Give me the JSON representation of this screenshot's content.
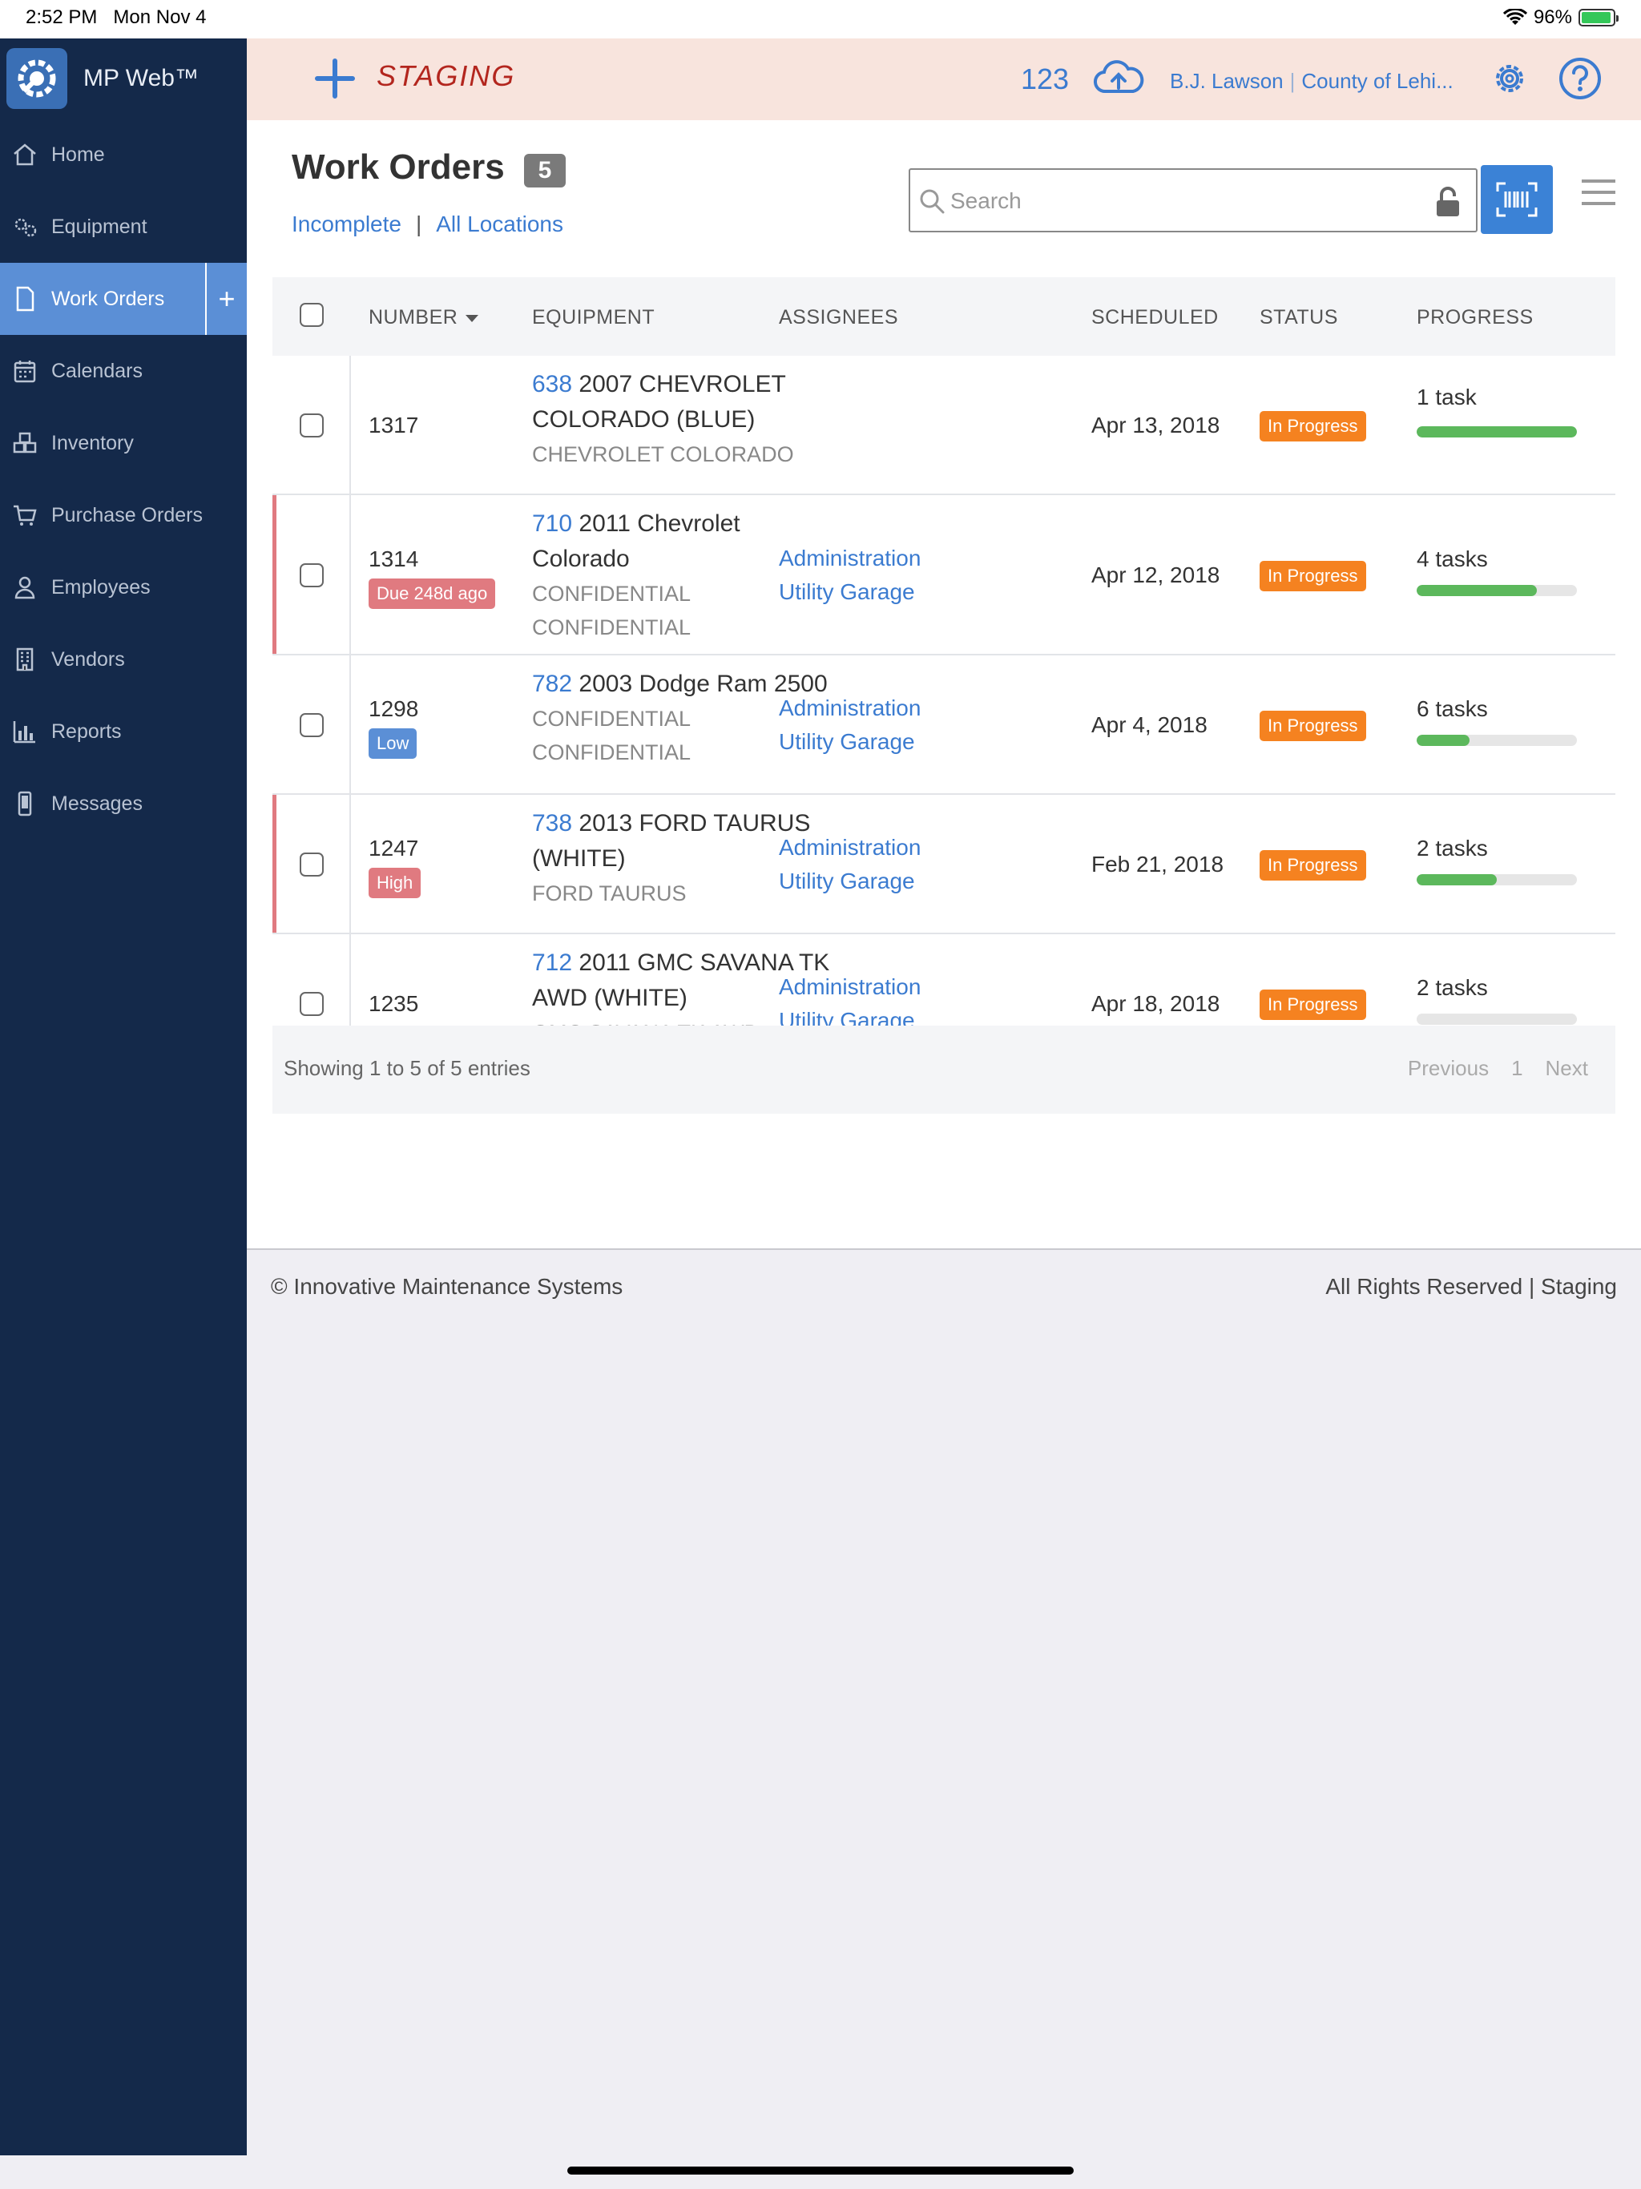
{
  "status_bar": {
    "time": "2:52 PM",
    "date": "Mon Nov 4",
    "battery": "96%",
    "battery_level": 0.96
  },
  "app": {
    "name": "MP Web™"
  },
  "sidebar": {
    "items": [
      {
        "label": "Home",
        "icon": "home-icon"
      },
      {
        "label": "Equipment",
        "icon": "gears-icon"
      },
      {
        "label": "Work Orders",
        "icon": "document-icon",
        "active": true
      },
      {
        "label": "Calendars",
        "icon": "calendar-icon"
      },
      {
        "label": "Inventory",
        "icon": "boxes-icon"
      },
      {
        "label": "Purchase Orders",
        "icon": "cart-icon"
      },
      {
        "label": "Employees",
        "icon": "person-icon"
      },
      {
        "label": "Vendors",
        "icon": "building-icon"
      },
      {
        "label": "Reports",
        "icon": "bar-chart-icon"
      },
      {
        "label": "Messages",
        "icon": "phone-icon"
      }
    ]
  },
  "header": {
    "environment": "STAGING",
    "count": "123",
    "user": "B.J. Lawson",
    "org": "County of Lehi...",
    "accent": "#3b7bd0",
    "env_color": "#b3261e"
  },
  "page": {
    "title": "Work Orders",
    "badge": "5",
    "filter_status": "Incomplete",
    "filter_divider": "|",
    "filter_location": "All Locations",
    "search_placeholder": "Search"
  },
  "table": {
    "headers": {
      "number": "NUMBER",
      "equipment": "EQUIPMENT",
      "assignees": "ASSIGNEES",
      "scheduled": "SCHEDULED",
      "status": "STATUS",
      "progress": "PROGRESS"
    },
    "rows": [
      {
        "number": "1317",
        "badge": "",
        "equip_id": "638",
        "equip_name": " 2007 CHEVROLET",
        "equip_name2": "COLORADO (BLUE)",
        "sub1": "CHEVROLET COLORADO",
        "sub2": "",
        "assignee1": "",
        "assignee2": "",
        "scheduled": "Apr 13, 2018",
        "status": "In Progress",
        "tasks": "1 task",
        "progress": 1.0
      },
      {
        "number": "1314",
        "badge": "Due 248d ago",
        "equip_id": "710",
        "equip_name": " 2011 Chevrolet",
        "equip_name2": "Colorado",
        "sub1": "CONFIDENTIAL",
        "sub2": "CONFIDENTIAL",
        "assignee1": "Administration",
        "assignee2": "Utility Garage",
        "scheduled": "Apr 12, 2018",
        "status": "In Progress",
        "tasks": "4 tasks",
        "progress": 0.75
      },
      {
        "number": "1298",
        "badge": "Low",
        "equip_id": "782",
        "equip_name": " 2003 Dodge Ram 2500",
        "equip_name2": "",
        "sub1": "CONFIDENTIAL",
        "sub2": "CONFIDENTIAL",
        "assignee1": "Administration",
        "assignee2": "Utility Garage",
        "scheduled": "Apr 4, 2018",
        "status": "In Progress",
        "tasks": "6 tasks",
        "progress": 0.33
      },
      {
        "number": "1247",
        "badge": "High",
        "equip_id": "738",
        "equip_name": " 2013 FORD TAURUS",
        "equip_name2": "(WHITE)",
        "sub1": "FORD TAURUS",
        "sub2": "",
        "assignee1": "Administration",
        "assignee2": "Utility Garage",
        "scheduled": "Feb 21, 2018",
        "status": "In Progress",
        "tasks": "2 tasks",
        "progress": 0.5
      },
      {
        "number": "1235",
        "badge": "",
        "equip_id": "712",
        "equip_name": " 2011 GMC SAVANA TK",
        "equip_name2": "AWD (WHITE)",
        "sub1": "GMC SAVANA TK AWD",
        "sub2": "",
        "assignee1": "Administration",
        "assignee2": "Utility Garage",
        "scheduled": "Apr 18, 2018",
        "status": "In Progress",
        "tasks": "2 tasks",
        "progress": 0.0
      }
    ],
    "footer_info": "Showing 1 to 5 of 5 entries",
    "pager": {
      "previous": "Previous",
      "page": "1",
      "next": "Next"
    }
  },
  "footer": {
    "left": "© Innovative Maintenance Systems",
    "right": "All Rights Reserved | Staging"
  }
}
